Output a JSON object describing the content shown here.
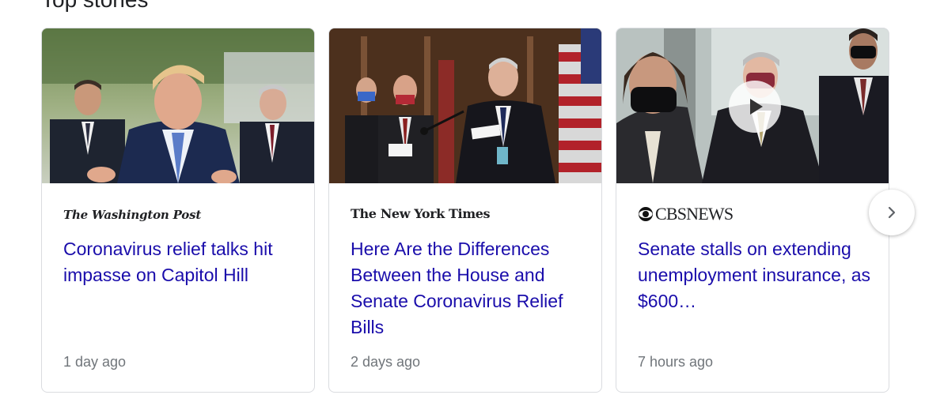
{
  "section": {
    "title": "Top stories"
  },
  "stories": [
    {
      "source": "The Washington Post",
      "headline": "Coronavirus relief talks hit impasse on Capitol Hill",
      "time": "1 day ago",
      "has_video": false
    },
    {
      "source": "The New York Times",
      "headline": "Here Are the Differences Between the House and Senate Coronavirus Relief Bills",
      "time": "2 days ago",
      "has_video": false
    },
    {
      "source": "CBSNEWS",
      "headline": "Senate stalls on extending unemployment insurance, as $600…",
      "time": "7 hours ago",
      "has_video": true
    }
  ],
  "icons": {
    "play": "play-icon",
    "next": "chevron-right-icon",
    "cbs_logo": "cbs-eye-icon"
  },
  "colors": {
    "headline": "#1a0dab",
    "timestamp": "#70757a",
    "card_border": "#dadce0"
  }
}
